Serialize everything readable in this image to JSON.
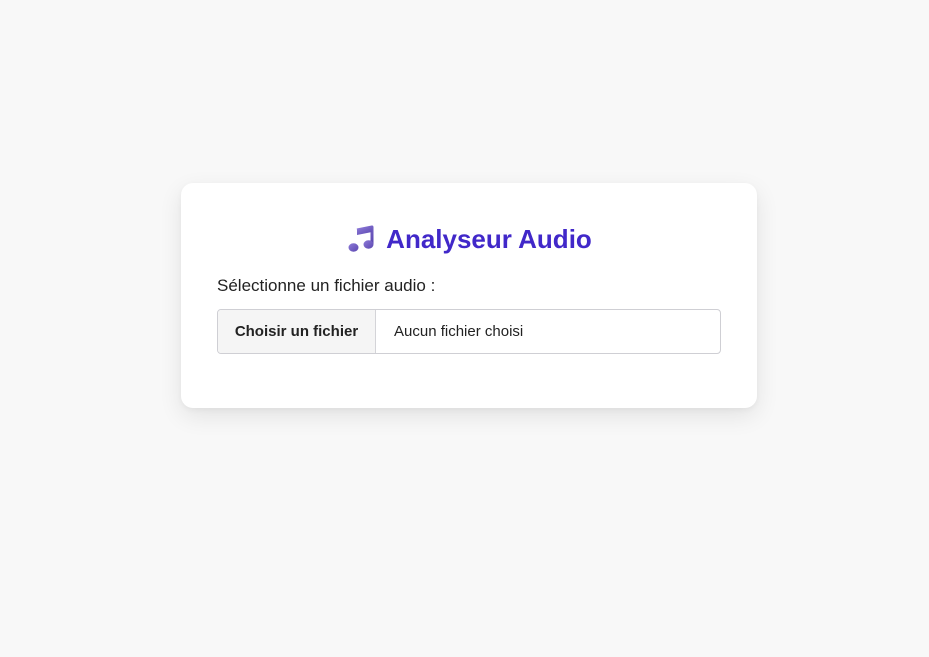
{
  "app": {
    "title": "Analyseur Audio",
    "title_icon": "music-note-icon",
    "accent_color": "#4128c9"
  },
  "upload": {
    "label": "Sélectionne un fichier audio :",
    "button_label": "Choisir un fichier",
    "file_status": "Aucun fichier choisi"
  }
}
